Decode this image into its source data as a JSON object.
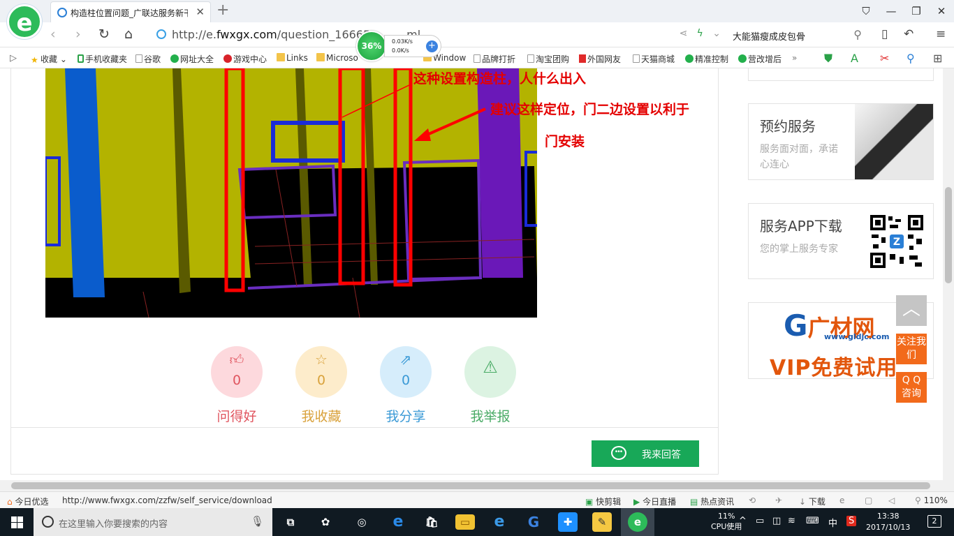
{
  "browser": {
    "tab_title": "构造柱位置问题_广联达服务新干线",
    "url_prefix": "http://e.",
    "url_domain": "fwxgx.com",
    "url_path": "/question_16665",
    "url_suffix": "ml",
    "search_text": "大能猫瘦成皮包骨",
    "speed_percent": "36%",
    "speed_up": "0.03K/s",
    "speed_down": "0.0K/s"
  },
  "bookmarks": [
    {
      "label": "收藏",
      "icon": "star-icon"
    },
    {
      "label": "手机收藏夹",
      "icon": "phone-icon"
    },
    {
      "label": "谷歌",
      "icon": "page-icon"
    },
    {
      "label": "网址大全",
      "icon": "green-circle-icon"
    },
    {
      "label": "游戏中心",
      "icon": "red-circle-icon"
    },
    {
      "label": "Links",
      "icon": "folder-icon"
    },
    {
      "label": "Microso",
      "icon": "folder-icon"
    },
    {
      "label": "Window",
      "icon": "folder-icon"
    },
    {
      "label": "品牌打折",
      "icon": "page-icon"
    },
    {
      "label": "淘宝团购",
      "icon": "page-icon"
    },
    {
      "label": "外国网友",
      "icon": "red-page-icon"
    },
    {
      "label": "天猫商城",
      "icon": "page-icon"
    },
    {
      "label": "精准控制",
      "icon": "green-circle-icon"
    },
    {
      "label": "营改增后",
      "icon": "green-circle-icon"
    }
  ],
  "annotations": {
    "line1": "这种设置构造柱，人什么出入",
    "line2": "建议这样定位，门二边设置以利于",
    "line3": "门安装"
  },
  "actions": [
    {
      "label": "问得好",
      "count": "0",
      "icon": "thumbs-up-icon",
      "color": "#e0555f",
      "bg": "#fdd9dd"
    },
    {
      "label": "我收藏",
      "count": "0",
      "icon": "star-icon",
      "color": "#d9a23c",
      "bg": "#fdeccb"
    },
    {
      "label": "我分享",
      "count": "0",
      "icon": "share-icon",
      "color": "#3b9ad6",
      "bg": "#d6edfb"
    },
    {
      "label": "我举报",
      "count": "",
      "icon": "warning-icon",
      "color": "#4aab66",
      "bg": "#dcf3e2"
    }
  ],
  "answer_button": "我来回答",
  "sidebar": {
    "booking_title": "预约服务",
    "booking_sub": "服务面对面，承诺心连心",
    "app_title": "服务APP下载",
    "app_sub": "您的掌上服务专家",
    "ad_brand": "广材网",
    "ad_url": "www.gldjc.com",
    "ad_vip": "VIP免费试用"
  },
  "floating": {
    "follow": "关注我们",
    "qq": "Q Q 咨询"
  },
  "statusbar": {
    "left": "今日优选",
    "url": "http://www.fwxgx.com/zzfw/self_service/download",
    "items": [
      "快剪辑",
      "今日直播",
      "热点资讯",
      "下载"
    ],
    "zoom": "110%"
  },
  "taskbar": {
    "search_placeholder": "在这里输入你要搜索的内容",
    "cpu_percent": "11%",
    "cpu_label": "CPU使用",
    "ime": "中",
    "time": "13:38",
    "date": "2017/10/13",
    "notifications": "2"
  },
  "colors": {
    "accent_green": "#18a858",
    "annotation_red": "#e40000",
    "float_orange": "#f26a1b"
  }
}
